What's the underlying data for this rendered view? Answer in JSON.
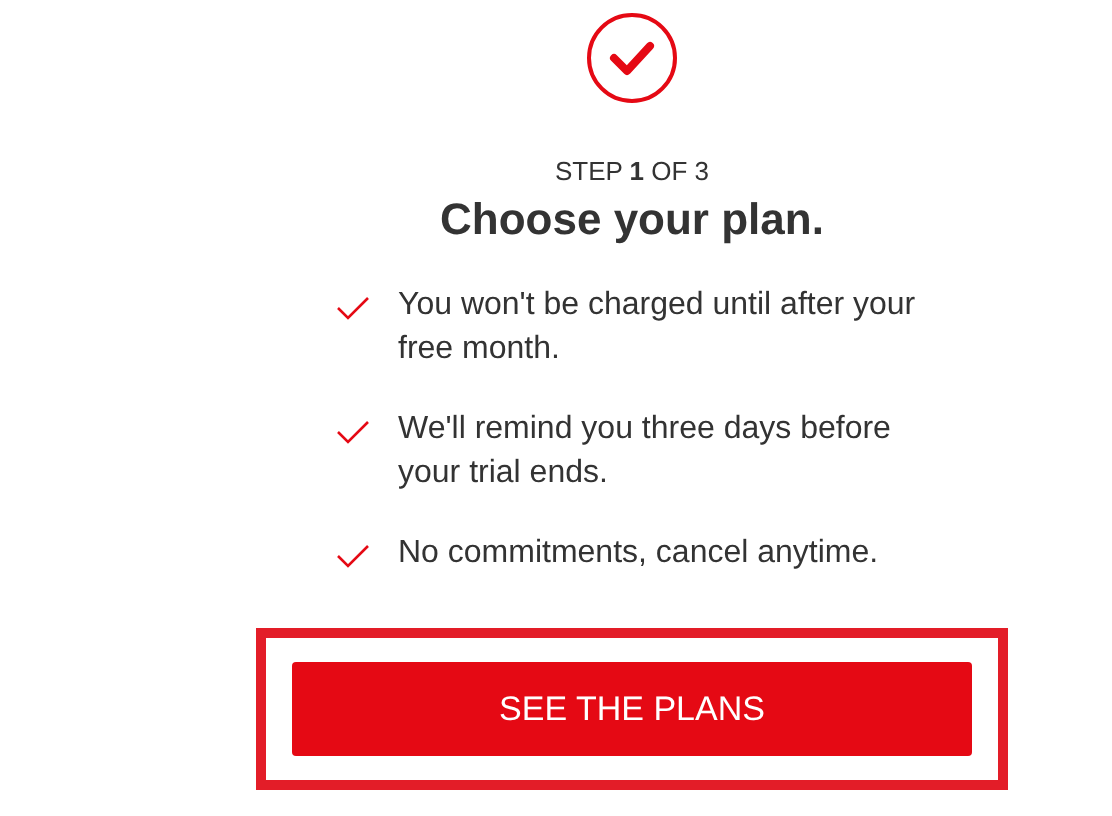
{
  "step_label": "STEP **1** OF 3",
  "heading": "Choose your plan.",
  "benefits": [
    {
      "text": "You won't be charged until after your free month."
    },
    {
      "text": "We'll remind you three days before your trial ends."
    },
    {
      "text": "No commitments, cancel anytime."
    }
  ],
  "primary_button": {
    "label": "SEE THE PLANS"
  }
}
